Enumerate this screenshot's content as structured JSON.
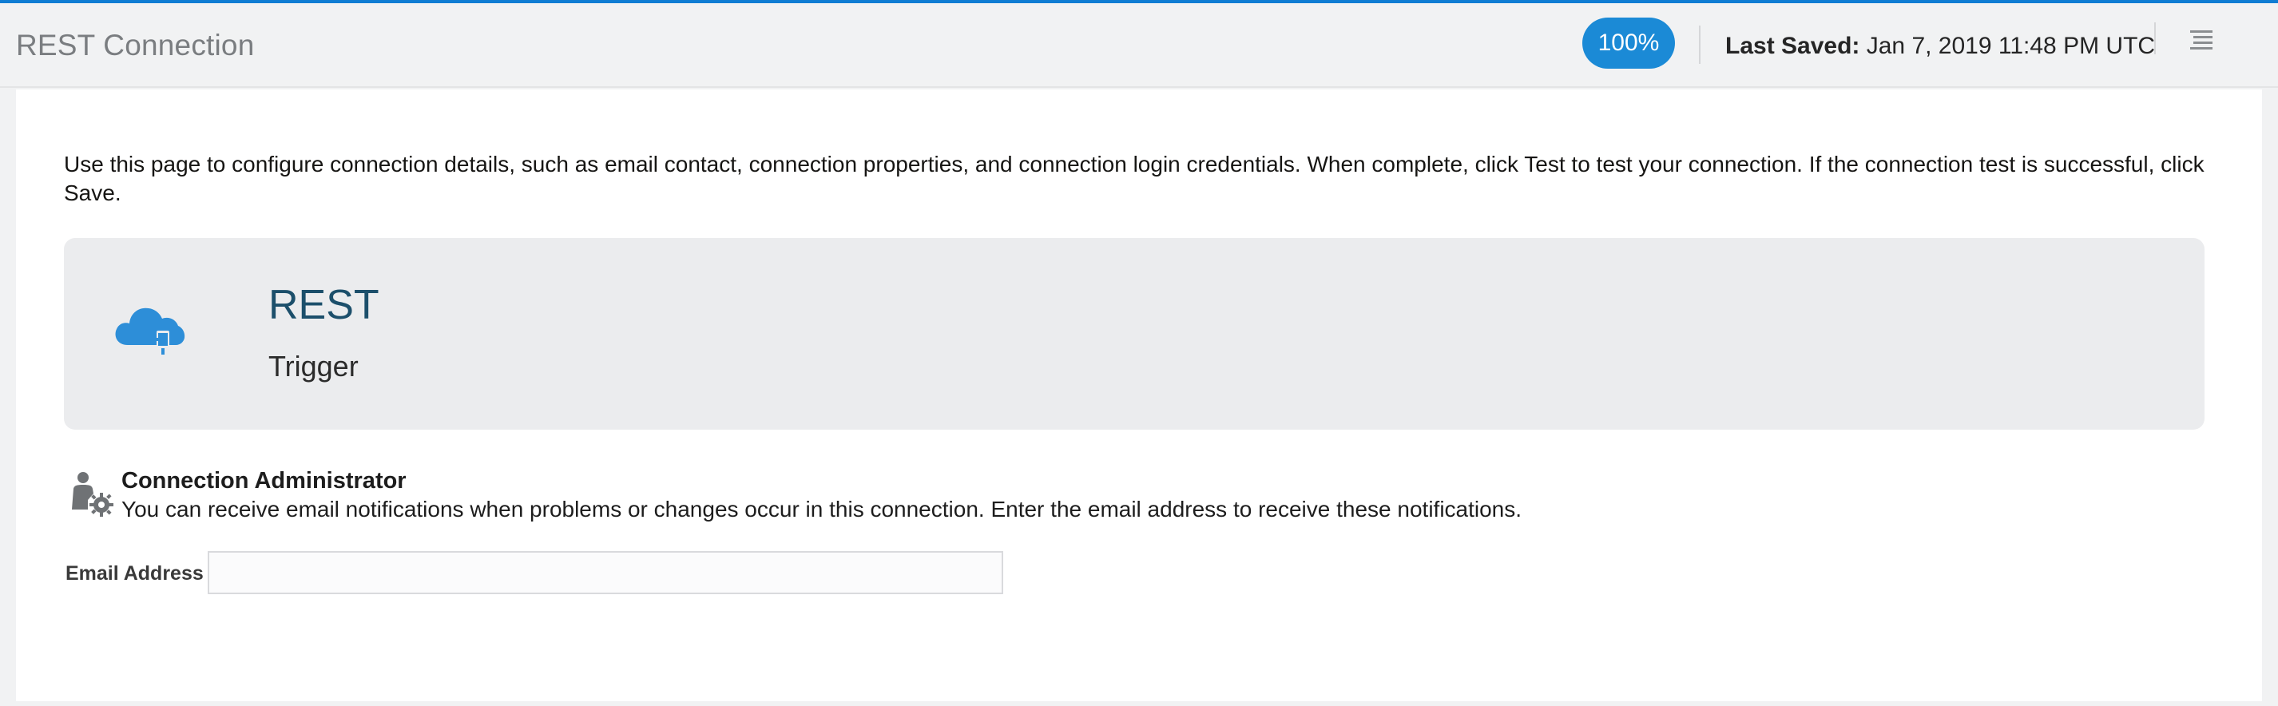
{
  "header": {
    "title": "REST Connection",
    "progress_badge": "100%",
    "last_saved_label": "Last Saved:",
    "last_saved_value": "Jan 7, 2019 11:48 PM UTC",
    "menu_icon": "hamburger-menu-icon"
  },
  "colors": {
    "accent": "#1b8ad6",
    "top_border": "#0f7dd3",
    "card_background": "#ebecee",
    "card_title": "#1c4f6b"
  },
  "intro_text": "Use this page to configure connection details, such as email contact, connection properties, and connection login credentials. When complete, click Test to test your connection. If the connection test is successful, click Save.",
  "adapter_card": {
    "icon": "rest-cloud-icon",
    "name": "REST",
    "role": "Trigger"
  },
  "admin_section": {
    "icon": "admin-gear-icon",
    "title": "Connection Administrator",
    "description": "You can receive email notifications when problems or changes occur in this connection. Enter the email address to receive these notifications."
  },
  "email_field": {
    "label": "Email Address",
    "value": "",
    "placeholder": ""
  }
}
